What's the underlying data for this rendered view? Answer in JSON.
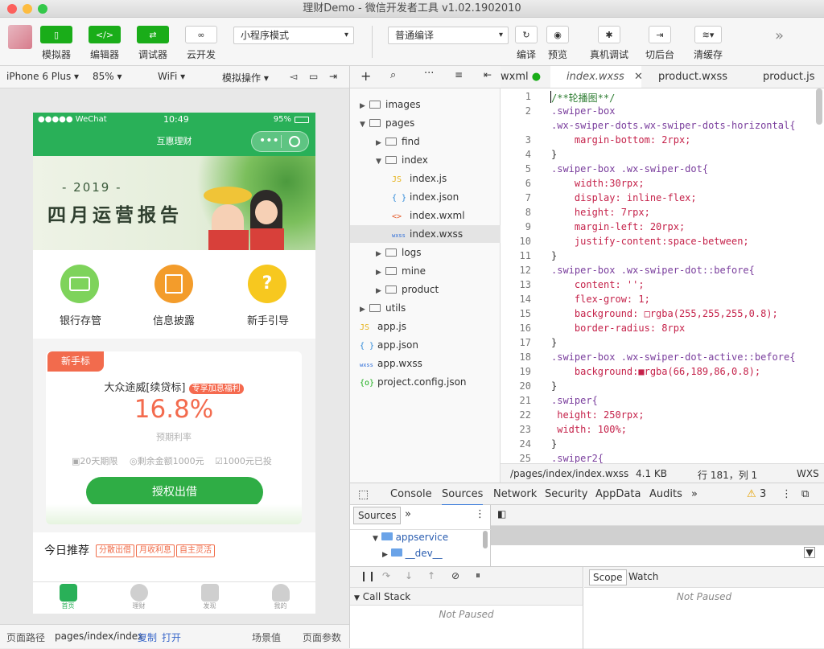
{
  "window": {
    "title": "理财Demo - 微信开发者工具 v1.02.1902010"
  },
  "toolbar": {
    "simulator": "模拟器",
    "editor": "编辑器",
    "debugger": "调试器",
    "cloud": "云开发",
    "mode_select": "小程序模式",
    "compile_select": "普通编译",
    "compile": "编译",
    "preview": "预览",
    "remote_debug": "真机调试",
    "background": "切后台",
    "clear_cache": "清缓存",
    "more": "»"
  },
  "devbar": {
    "device": "iPhone 6 Plus",
    "zoom": "85%",
    "network": "WiFi",
    "sim_ops": "模拟操作"
  },
  "phone": {
    "status_left": "●●●●● WeChat",
    "status_time": "10:49",
    "status_battery": "95%",
    "nav_title": "互惠理财",
    "banner_year": "- 2019 -",
    "banner_title": "四月运营报告",
    "quick": [
      "银行存管",
      "信息披露",
      "新手引导"
    ],
    "card": {
      "tag": "新手标",
      "product": "大众途威[续贷标]",
      "badge": "专享加息福利",
      "rate": "16.8%",
      "rate_label": "预期利率",
      "meta1": "20天期限",
      "meta2": "剩余金额1000元",
      "meta3": "1000元已投",
      "button": "授权出借"
    },
    "recommend": {
      "title": "今日推荐",
      "tags": [
        "分散出借",
        "月收利息",
        "自主灵活"
      ]
    },
    "tabs": [
      "首页",
      "理财",
      "发现",
      "我的"
    ]
  },
  "bottombar": {
    "path_label": "页面路径",
    "path": "pages/index/index",
    "copy": "复制",
    "open": "打开",
    "scene": "场景值",
    "params": "页面参数"
  },
  "tree": [
    {
      "name": "images",
      "type": "folder",
      "level": 0,
      "open": false
    },
    {
      "name": "pages",
      "type": "folder",
      "level": 0,
      "open": true
    },
    {
      "name": "find",
      "type": "folder",
      "level": 1,
      "open": false
    },
    {
      "name": "index",
      "type": "folder",
      "level": 1,
      "open": true
    },
    {
      "name": "index.js",
      "type": "js",
      "level": 2
    },
    {
      "name": "index.json",
      "type": "json",
      "level": 2
    },
    {
      "name": "index.wxml",
      "type": "wxml",
      "level": 2
    },
    {
      "name": "index.wxss",
      "type": "wxss",
      "level": 2,
      "selected": true
    },
    {
      "name": "logs",
      "type": "folder",
      "level": 1,
      "open": false
    },
    {
      "name": "mine",
      "type": "folder",
      "level": 1,
      "open": false
    },
    {
      "name": "product",
      "type": "folder",
      "level": 1,
      "open": false
    },
    {
      "name": "utils",
      "type": "folder",
      "level": 0,
      "open": false
    },
    {
      "name": "app.js",
      "type": "js",
      "level": 0
    },
    {
      "name": "app.json",
      "type": "json",
      "level": 0
    },
    {
      "name": "app.wxss",
      "type": "wxss",
      "level": 0
    },
    {
      "name": "project.config.json",
      "type": "config",
      "level": 0
    }
  ],
  "editor_tabs": {
    "t0": "wxml",
    "t1": "index.wxss",
    "t2": "product.wxss",
    "t3": "product.js"
  },
  "code": [
    {
      "n": "1",
      "t": "/**轮播图**/"
    },
    {
      "n": "2",
      "t": ".swiper-box"
    },
    {
      "n": "",
      "t": ".wx-swiper-dots.wx-swiper-dots-horizontal{"
    },
    {
      "n": "3",
      "t": "    margin-bottom: 2rpx;"
    },
    {
      "n": "4",
      "t": "}"
    },
    {
      "n": "5",
      "t": ".swiper-box .wx-swiper-dot{"
    },
    {
      "n": "6",
      "t": "    width:30rpx;"
    },
    {
      "n": "7",
      "t": "    display: inline-flex;"
    },
    {
      "n": "8",
      "t": "    height: 7rpx;"
    },
    {
      "n": "9",
      "t": "    margin-left: 20rpx;"
    },
    {
      "n": "10",
      "t": "    justify-content:space-between;"
    },
    {
      "n": "11",
      "t": "}"
    },
    {
      "n": "12",
      "t": ".swiper-box .wx-swiper-dot::before{"
    },
    {
      "n": "13",
      "t": "    content: '';"
    },
    {
      "n": "14",
      "t": "    flex-grow: 1;"
    },
    {
      "n": "15",
      "t": "    background: □rgba(255,255,255,0.8);"
    },
    {
      "n": "16",
      "t": "    border-radius: 8rpx"
    },
    {
      "n": "17",
      "t": "}"
    },
    {
      "n": "18",
      "t": ".swiper-box .wx-swiper-dot-active::before{"
    },
    {
      "n": "19",
      "t": "    background:■rgba(66,189,86,0.8);"
    },
    {
      "n": "20",
      "t": "}"
    },
    {
      "n": "21",
      "t": ".swiper{"
    },
    {
      "n": "22",
      "t": " height: 250rpx;"
    },
    {
      "n": "23",
      "t": " width: 100%;"
    },
    {
      "n": "24",
      "t": "}"
    },
    {
      "n": "25",
      "t": ".swiper2{"
    }
  ],
  "editor_status": {
    "path": "/pages/index/index.wxss",
    "size": "4.1 KB",
    "pos": "行 181，列 1",
    "lang": "WXS"
  },
  "devtools": {
    "tabs": [
      "Console",
      "Sources",
      "Network",
      "Security",
      "AppData",
      "Audits",
      "»"
    ],
    "warn_count": "3",
    "sources_tab": "Sources",
    "sources_more": "»",
    "tree_root": "appservice",
    "tree_child": "__dev__",
    "call_stack": "Call Stack",
    "not_paused": "Not Paused",
    "scope": "Scope",
    "watch": "Watch",
    "not_paused_right": "Not Paused"
  },
  "colors": {
    "brand_green": "#29b058",
    "accent_orange": "#f06d4a",
    "rate_color": "#f36b4e"
  }
}
